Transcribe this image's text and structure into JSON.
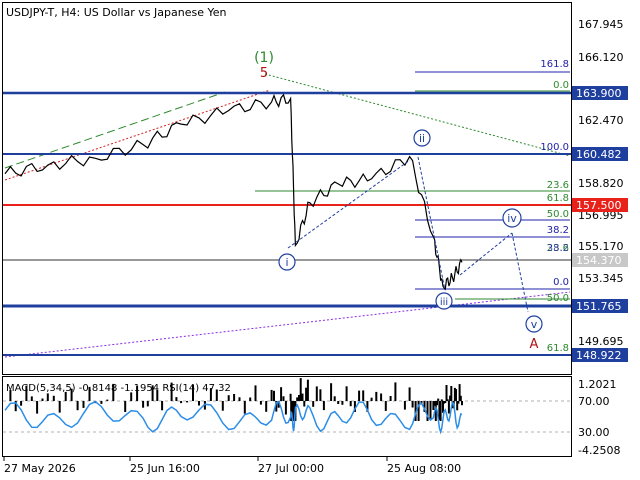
{
  "header": {
    "title": "USDJPY-T, H4:  US Dollar vs Japanese Yen"
  },
  "price_axis": {
    "ticks": [
      "167.945",
      "166.120",
      "162.470",
      "158.820",
      "156.995",
      "155.170",
      "153.345",
      "149.695"
    ]
  },
  "price_markers": [
    {
      "label": "163.900",
      "bg": "#1f3f9f",
      "fg": "#ffffff"
    },
    {
      "label": "160.482",
      "bg": "#1f3f9f",
      "fg": "#ffffff"
    },
    {
      "label": "157.500",
      "bg": "#e8221b",
      "fg": "#ffffff"
    },
    {
      "label": "154.370",
      "bg": "#c8c8c8",
      "fg": "#ffffff"
    },
    {
      "label": "151.765",
      "bg": "#1f3f9f",
      "fg": "#ffffff"
    },
    {
      "label": "148.922",
      "bg": "#1f3f9f",
      "fg": "#ffffff"
    }
  ],
  "fib_labels": {
    "f161": "161.8",
    "f0top": "0.0",
    "f100": "100.0",
    "f236": "23.6",
    "f618": "61.8",
    "f50a": "50.0",
    "f382": "38.2",
    "f236b": "23.6",
    "f382b": "38.2",
    "f0b": "0.0",
    "f50b": "50.0",
    "f618b": "61.8"
  },
  "wave_labels": {
    "w1": "(1)",
    "w5": "5",
    "wi": "i",
    "wii": "ii",
    "wiii": "iii",
    "wiv": "iv",
    "wv": "v",
    "wA": "A"
  },
  "indicator": {
    "title": "MACD(5,34,5) -0.8148 -1.1954 RSI(14) 47.32",
    "ticks": [
      "1.2021",
      "70.00",
      "30.00",
      "-4.2508"
    ]
  },
  "time_axis": {
    "labels": [
      "27 May 2026",
      "25 Jun 16:00",
      "27 Jul 00:00",
      "25 Aug 08:00"
    ]
  },
  "colors": {
    "bg": "#ffffff",
    "candles": "#000000",
    "level_blue": "#1f3f9f",
    "level_red": "#e8221b",
    "fib_blue": "#2222aa",
    "fib_green": "#2d8a2d",
    "wave_blue": "#1f3f9f",
    "wave_green": "#2d8a2d",
    "wave_red": "#b01010",
    "rsi": "#2b8de8",
    "grid": "#c0c0c0"
  },
  "chart_data": {
    "type": "line",
    "title": "USDJPY-T, H4:  US Dollar vs Japanese Yen",
    "x": [
      "2026-05-27",
      "2026-06-05",
      "2026-06-15",
      "2026-06-25",
      "2026-07-03",
      "2026-07-13",
      "2026-07-22",
      "2026-07-26",
      "2026-07-27",
      "2026-07-30",
      "2026-08-05",
      "2026-08-12",
      "2026-08-20",
      "2026-08-25",
      "2026-08-27",
      "2026-08-29",
      "2026-08-31"
    ],
    "series": [
      {
        "values": [
          159.5,
          160.0,
          160.4,
          161.2,
          162.4,
          163.2,
          163.7,
          163.9,
          155.3,
          157.8,
          158.9,
          159.2,
          160.5,
          155.8,
          152.9,
          153.4,
          154.3
        ]
      }
    ],
    "ylim": [
      148.0,
      168.5
    ],
    "levels": [
      163.9,
      160.482,
      157.5,
      154.37,
      151.765,
      148.922
    ],
    "grid": false,
    "indicator": {
      "macd": [
        -0.8148,
        -1.1954
      ],
      "rsi": 47.32,
      "ylim": [
        -4.2508,
        1.2021
      ]
    }
  }
}
